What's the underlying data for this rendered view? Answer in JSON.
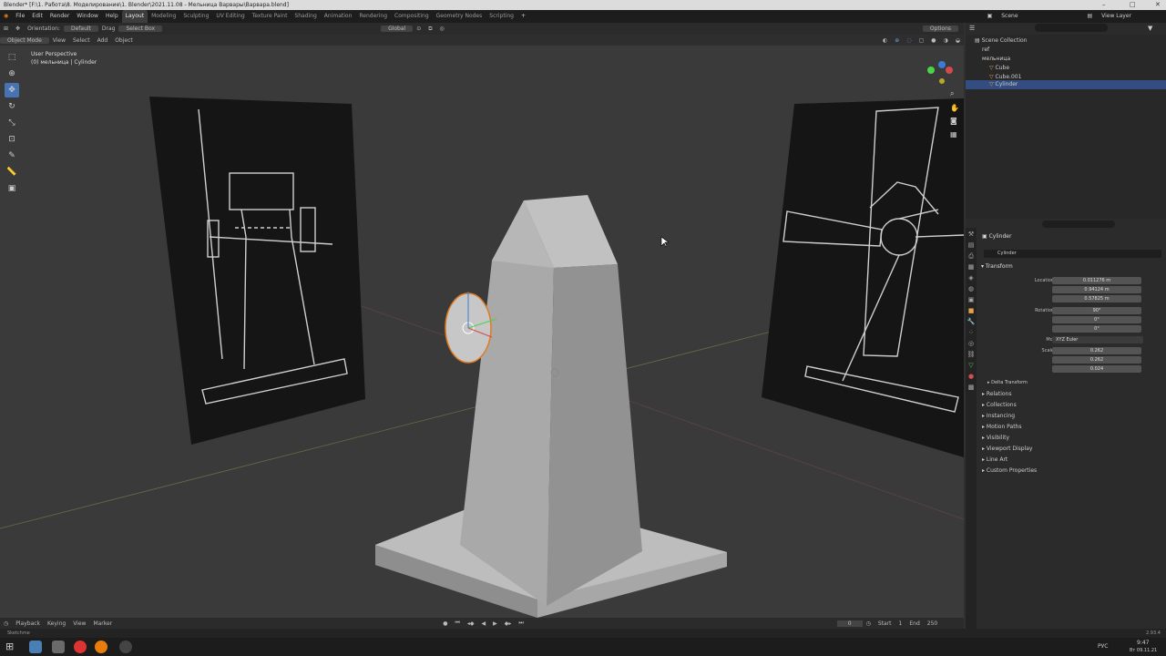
{
  "title": "Blender* [F:\\1. Работа\\8. Моделирование\\1. Blender\\2021.11.08 - Мельница Варвары\\Варвара.blend]",
  "menu": [
    "File",
    "Edit",
    "Render",
    "Window",
    "Help"
  ],
  "workspaces": [
    "Layout",
    "Modeling",
    "Sculpting",
    "UV Editing",
    "Texture Paint",
    "Shading",
    "Animation",
    "Rendering",
    "Compositing",
    "Geometry Nodes",
    "Scripting"
  ],
  "active_workspace": "Layout",
  "scene": {
    "label": "Scene",
    "view_layer": "View Layer"
  },
  "tool_header": {
    "orientation_label": "Orientation:",
    "orientation": "Default",
    "drag_label": "Drag",
    "drag": "Select Box",
    "transform": "Global",
    "options": "Options"
  },
  "viewport_header": {
    "mode": "Object Mode",
    "items": [
      "View",
      "Select",
      "Add",
      "Object"
    ]
  },
  "viewport_info": {
    "line1": "User Perspective",
    "line2": "(0) мельница | Cylinder"
  },
  "outliner": {
    "root": "Scene Collection",
    "rows": [
      {
        "name": "ref",
        "indent": 1,
        "selected": false
      },
      {
        "name": "мельница",
        "indent": 1,
        "selected": false
      },
      {
        "name": "Cube",
        "indent": 2,
        "selected": false
      },
      {
        "name": "Cube.001",
        "indent": 2,
        "selected": false
      },
      {
        "name": "Cylinder",
        "indent": 2,
        "selected": true
      }
    ]
  },
  "properties": {
    "object_name": "Cylinder",
    "object_field": "Cylinder",
    "transform_label": "Transform",
    "location": {
      "label": "Location X",
      "x": "0.011276 m",
      "y": "0.94124 m",
      "z": "0.57825 m"
    },
    "rotation": {
      "label": "Rotation X",
      "x": "90°",
      "y": "0°",
      "z": "0°"
    },
    "mode": {
      "label": "Mode",
      "value": "XYZ Euler"
    },
    "scale": {
      "label": "Scale X",
      "x": "0.262",
      "y": "0.262",
      "z": "0.024"
    },
    "axis_y": "Y",
    "axis_z": "Z",
    "panels": [
      "Delta Transform",
      "Relations",
      "Collections",
      "Instancing",
      "Motion Paths",
      "Visibility",
      "Viewport Display",
      "Line Art",
      "Custom Properties"
    ]
  },
  "timeline": {
    "items": [
      "Playback",
      "Keying",
      "View",
      "Marker"
    ],
    "frame": "0",
    "start_label": "Start",
    "start": "1",
    "end_label": "End",
    "end": "250"
  },
  "statusbar": {
    "left": "Sketchme",
    "right": "2.93.4"
  },
  "clock": {
    "time": "9:47",
    "date": "Вт 09.11.21",
    "lang": "РУС"
  }
}
